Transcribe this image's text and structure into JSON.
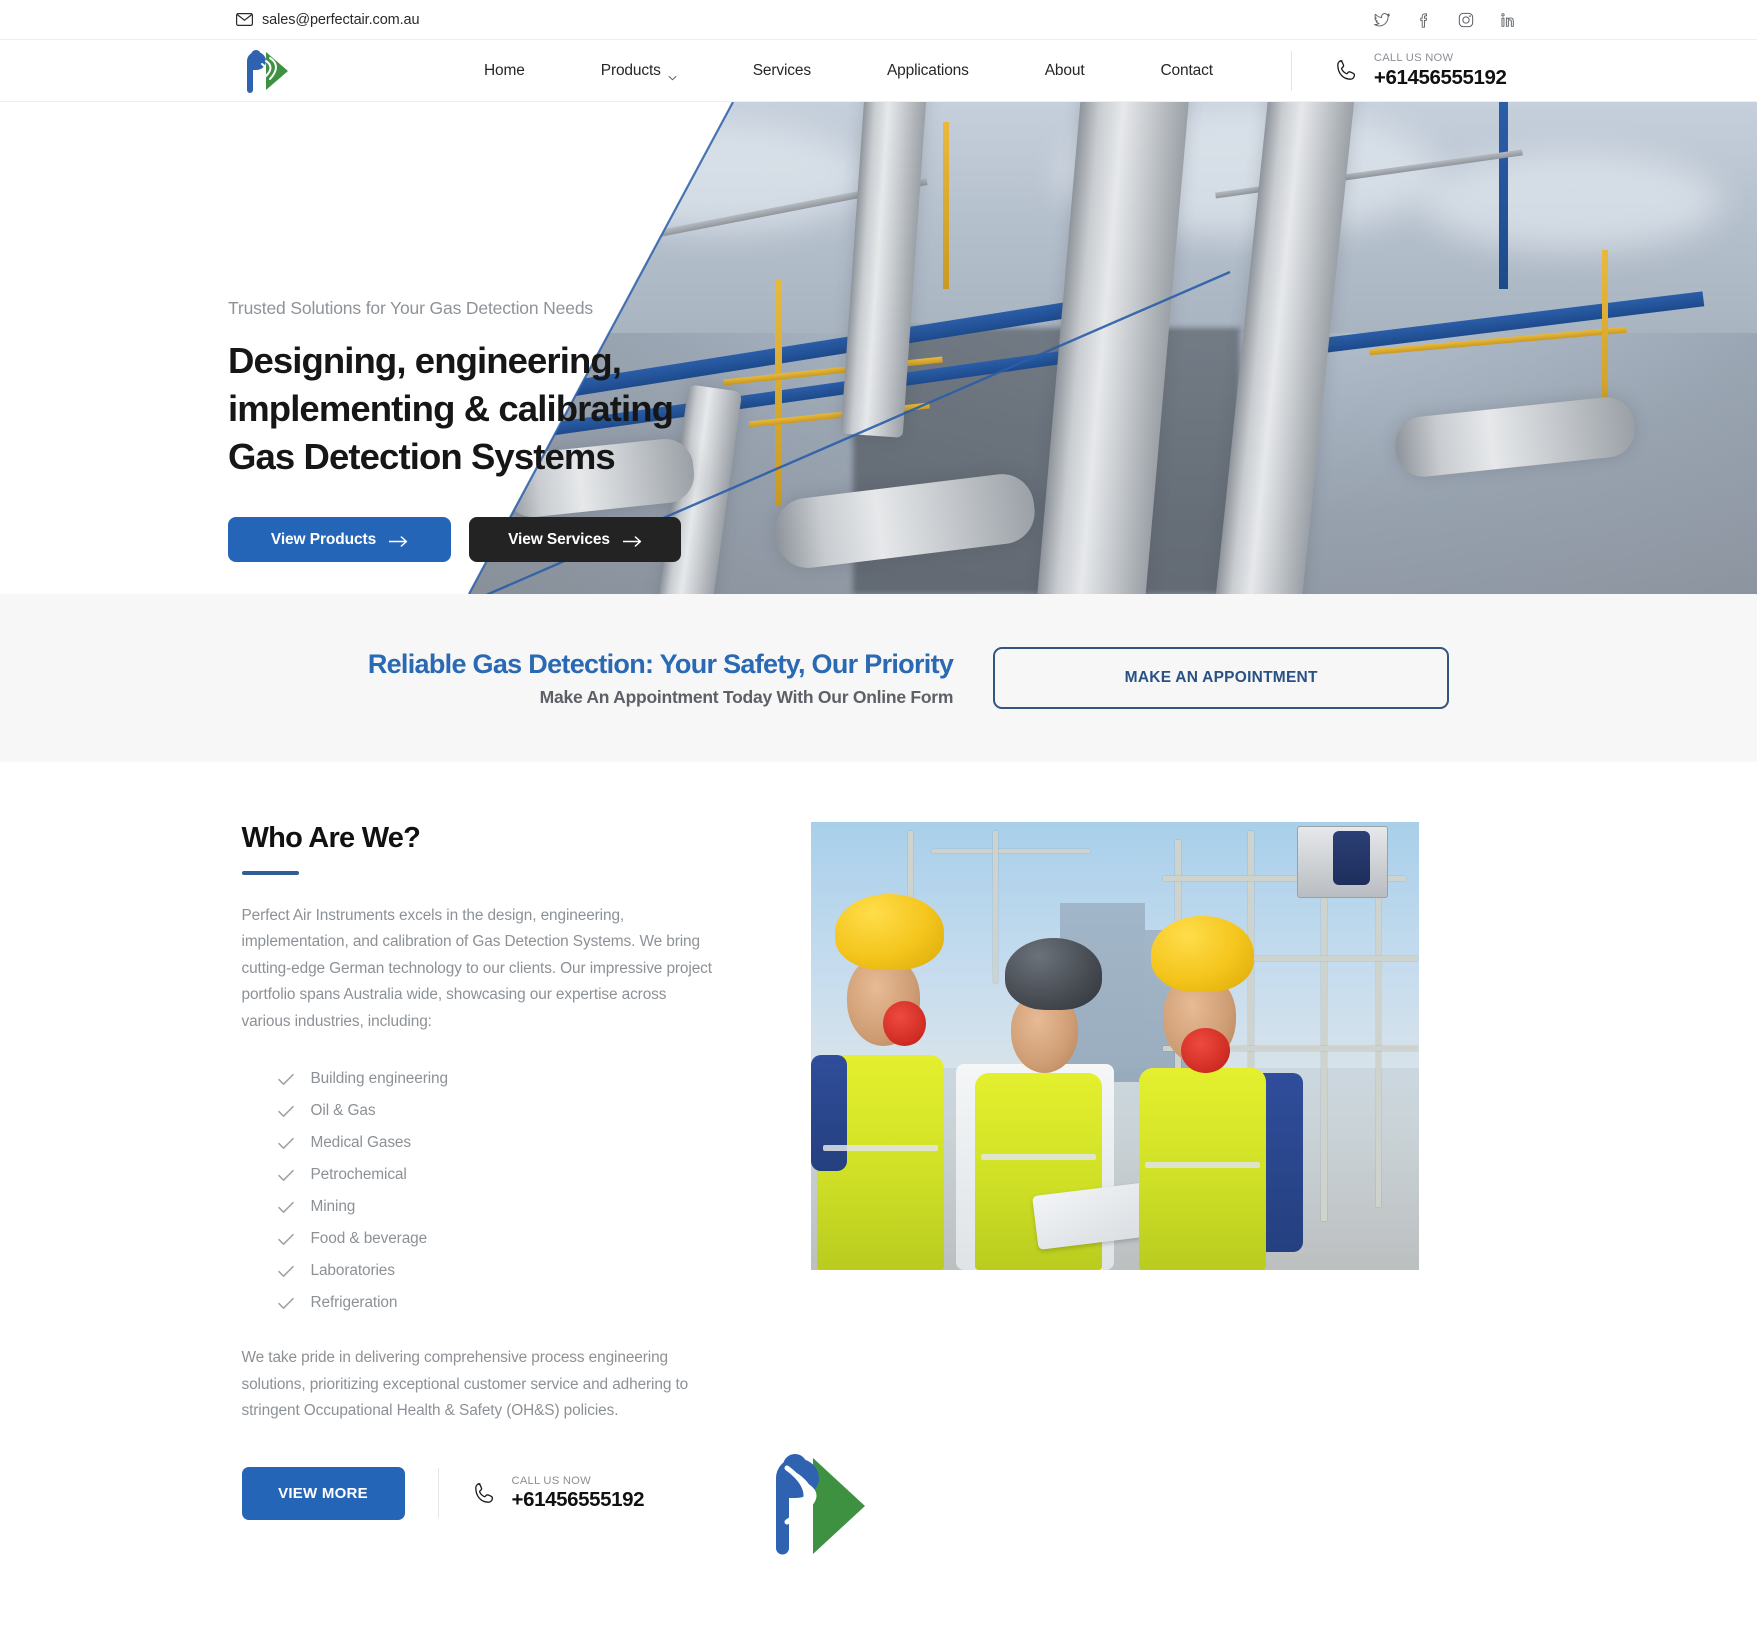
{
  "topbar": {
    "email": "sales@perfectair.com.au",
    "mail_icon": "envelope-icon",
    "social": [
      {
        "name": "twitter-icon",
        "label": "Twitter"
      },
      {
        "name": "facebook-icon",
        "label": "Facebook"
      },
      {
        "name": "instagram-icon",
        "label": "Instagram"
      },
      {
        "name": "linkedin-icon",
        "label": "LinkedIn"
      }
    ]
  },
  "nav": {
    "logo_alt": "Perfect Air Instruments logo",
    "links": [
      {
        "label": "Home",
        "has_caret": false
      },
      {
        "label": "Products",
        "has_caret": true
      },
      {
        "label": "Services",
        "has_caret": false
      },
      {
        "label": "Applications",
        "has_caret": false
      },
      {
        "label": "About",
        "has_caret": false
      },
      {
        "label": "Contact",
        "has_caret": false
      }
    ],
    "call_label": "CALL US NOW",
    "phone": "+61456555192",
    "phone_icon": "phone-icon"
  },
  "hero": {
    "kicker": "Trusted Solutions for Your Gas Detection Needs",
    "title": "Designing, engineering, implementing & calibrating Gas Detection Systems",
    "primary_btn": "View Products",
    "secondary_btn": "View Services",
    "arrow_icon": "arrow-right-icon",
    "image_alt": "Industrial gas processing plant with pipes and towers"
  },
  "appointment": {
    "title": "Reliable Gas Detection: Your Safety, Our Priority",
    "subtitle": "Make An Appointment Today With Our Online Form",
    "button": "MAKE AN APPOINTMENT"
  },
  "who": {
    "title": "Who Are We?",
    "paragraph1": "Perfect Air Instruments excels in the design, engineering, implementation, and calibration of Gas Detection Systems. We bring cutting-edge German technology to our clients. Our impressive project portfolio spans Australia wide, showcasing our expertise across various industries, including:",
    "list": [
      "Building engineering",
      "Oil & Gas",
      "Medical Gases",
      "Petrochemical",
      "Mining",
      "Food & beverage",
      "Laboratories",
      "Refrigeration"
    ],
    "paragraph2": "We take pride in delivering comprehensive process engineering solutions, prioritizing exceptional customer service and adhering to stringent Occupational Health & Safety (OH&S) policies.",
    "view_more": "VIEW MORE",
    "call_label": "CALL US NOW",
    "phone": "+61456555192",
    "image_alt": "Three construction engineers in hi-vis vests and hard hats reviewing a tablet on site",
    "check_icon": "check-icon"
  },
  "colors": {
    "primary_blue": "#2565b8",
    "dark_button": "#232323",
    "banner_blue": "#2a69b3",
    "banner_bg": "#f7f7f7",
    "accent_rule": "#2f5d96",
    "muted_text": "#8c9196",
    "logo_blue": "#2f62b0",
    "logo_green": "#3f9142"
  }
}
